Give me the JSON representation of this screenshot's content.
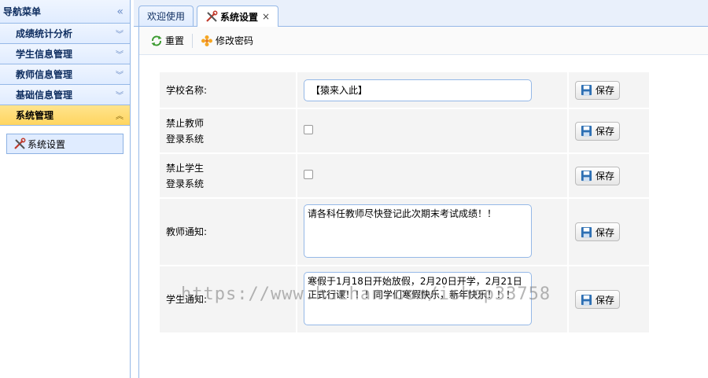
{
  "sidebar": {
    "title": "导航菜单",
    "sections": [
      {
        "label": "成绩统计分析"
      },
      {
        "label": "学生信息管理"
      },
      {
        "label": "教师信息管理"
      },
      {
        "label": "基础信息管理"
      },
      {
        "label": "系统管理"
      }
    ],
    "items": [
      {
        "label": "系统设置"
      }
    ]
  },
  "tabs": [
    {
      "label": "欢迎使用"
    },
    {
      "label": "系统设置",
      "close": "×"
    }
  ],
  "toolbar": {
    "reset_label": "重置",
    "change_password_label": "修改密码"
  },
  "form": {
    "school_name": {
      "label": "学校名称:",
      "value": "【猿来入此】"
    },
    "disable_teacher": {
      "label_line1": "禁止教师",
      "label_line2": "登录系统"
    },
    "disable_student": {
      "label_line1": "禁止学生",
      "label_line2": "登录系统"
    },
    "teacher_notice": {
      "label": "教师通知:",
      "value": "请各科任教师尽快登记此次期末考试成绩！！"
    },
    "student_notice": {
      "label": "学生通知:",
      "value": "寒假于1月18日开始放假，2月20日开学，2月21日正式行课！！！同学们寒假快乐，新年快乐！！！"
    },
    "save_label": "保存"
  },
  "watermark": "https://www.huzhan.com/ishop33758",
  "colors": {
    "accent": "#95b8e7",
    "selected": "#ffd560",
    "header_bg": "#e0ecff"
  }
}
